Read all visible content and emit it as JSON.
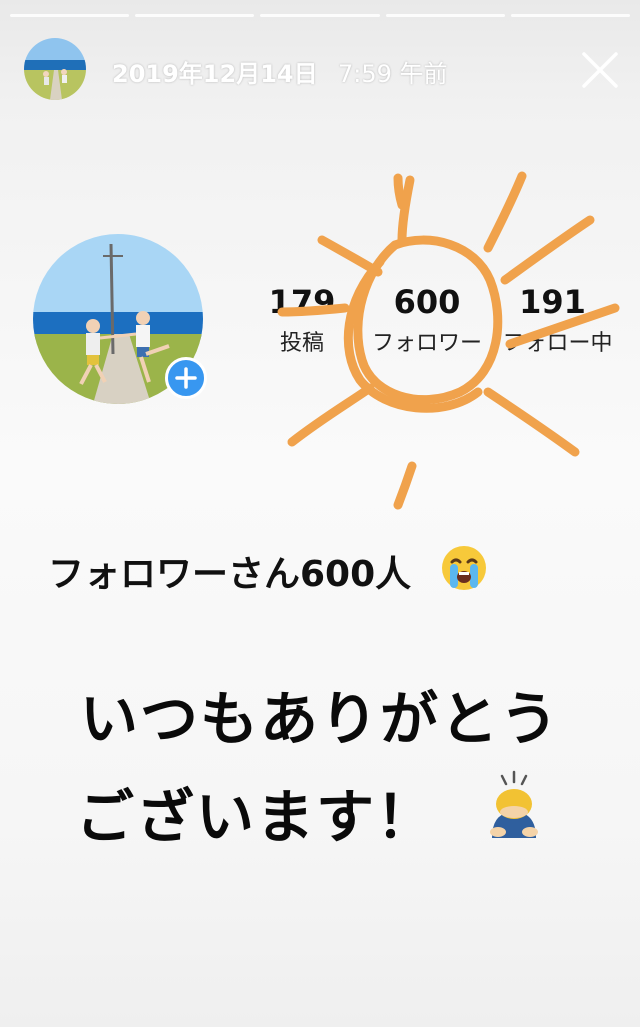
{
  "story": {
    "progress_segments": 5,
    "date": "2019年12月14日",
    "time": "7:59 午前"
  },
  "profile": {
    "stats": [
      {
        "number": "179",
        "label": "投稿"
      },
      {
        "number": "600",
        "label": "フォロワー"
      },
      {
        "number": "191",
        "label": "フォロー中"
      }
    ]
  },
  "caption": {
    "line1": "フォロワーさん600人",
    "line2": "いつもありがとう",
    "line3": "ございます！"
  },
  "icons": {
    "close": "close-icon",
    "plus": "plus-icon",
    "emoji1": "loudly-crying-face-emoji",
    "emoji2": "person-bowing-emoji"
  },
  "colors": {
    "scribble": "#f0a24c",
    "badge": "#3897f0"
  }
}
